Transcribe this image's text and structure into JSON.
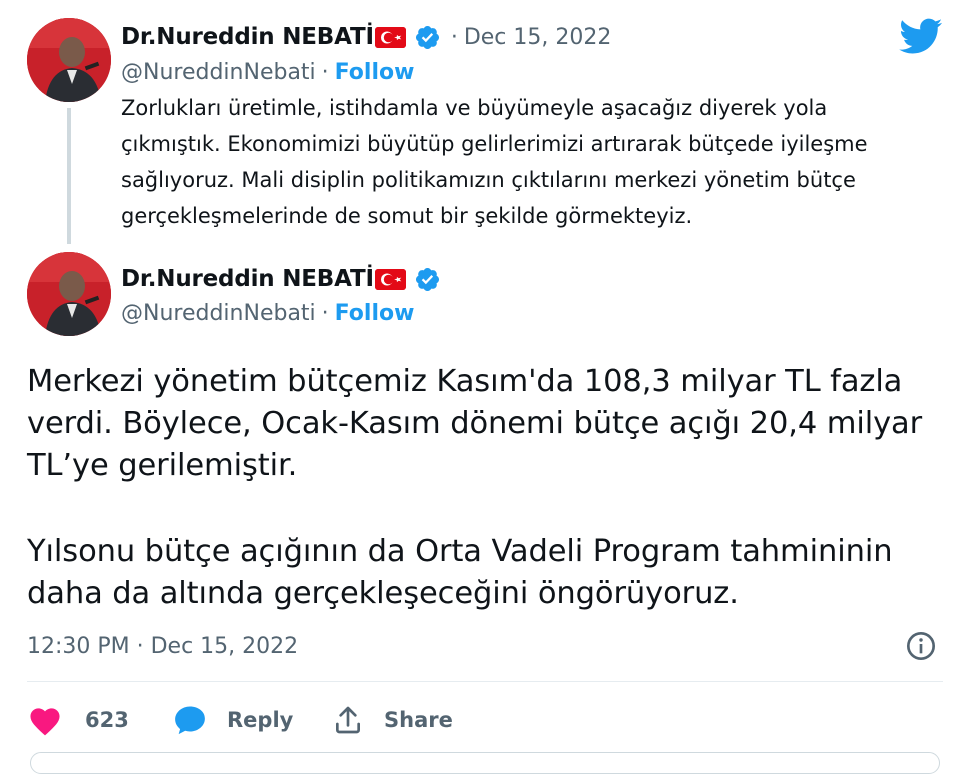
{
  "quoted_tweet": {
    "author_name": "Dr.Nureddin NEBATİ",
    "handle": "@NureddinNebati",
    "date_prefix": "·",
    "date": "Dec 15, 2022",
    "follow_label": "Follow",
    "text_lines": [
      "Zorlukları üretimle, istihdamla ve büyümeyle aşacağız diyerek yola",
      "çıkmıştık. Ekonomimizi büyütüp gelirlerimizi artırarak bütçede iyileşme",
      "sağlıyoruz. Mali disiplin politikamızın çıktılarını merkezi yönetim bütçe",
      "gerçekleşmelerinde de somut bir şekilde görmekteyiz."
    ]
  },
  "main_tweet": {
    "author_name": "Dr.Nureddin NEBATİ",
    "handle": "@NureddinNebati",
    "follow_label": "Follow",
    "paragraph1_lines": [
      "Merkezi yönetim bütçemiz Kasım'da 108,3 milyar TL fazla",
      "verdi. Böylece, Ocak-Kasım dönemi bütçe açığı 20,4 milyar",
      "TL’ye gerilemiştir."
    ],
    "paragraph2_lines": [
      "Yılsonu bütçe açığının da Orta Vadeli Program tahmininin",
      "daha da altında gerçekleşeceğini öngörüyoruz."
    ],
    "timestamp": "12:30 PM · Dec 15, 2022"
  },
  "actions": {
    "like_count": "623",
    "reply_label": "Reply",
    "share_label": "Share"
  },
  "icons": {
    "twitter": "twitter-bird-icon",
    "verified": "verified-badge-icon",
    "flag": "turkish-flag-icon",
    "info": "info-icon",
    "heart": "heart-icon",
    "reply": "reply-bubble-icon",
    "share": "share-upload-icon"
  },
  "colors": {
    "accent": "#1d9bf0",
    "like": "#f91880",
    "muted": "#536471"
  }
}
